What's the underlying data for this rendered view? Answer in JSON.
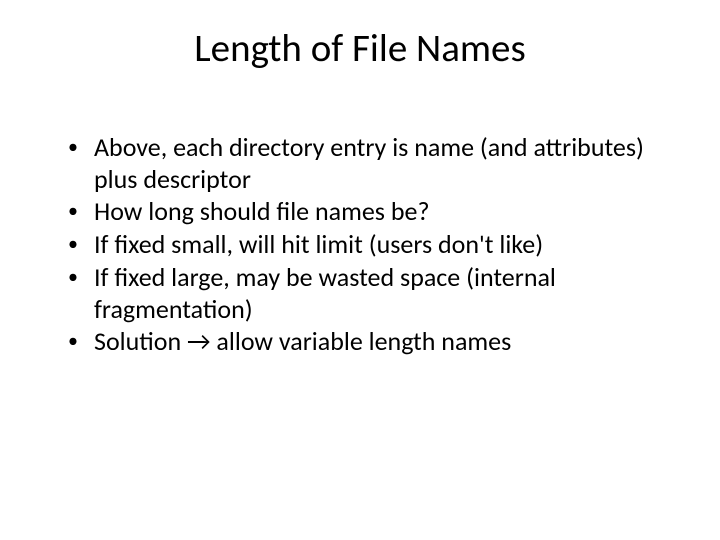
{
  "slide": {
    "title": "Length of File Names",
    "bullets": [
      {
        "text": "Above, each directory entry is name (and attributes) plus descriptor"
      },
      {
        "text": "How long should file names be?"
      },
      {
        "text": "If fixed small, will hit limit (users don't like)"
      },
      {
        "text": "If fixed large, may be wasted space (internal fragmentation)"
      },
      {
        "text": "Solution → allow variable length names"
      }
    ]
  }
}
